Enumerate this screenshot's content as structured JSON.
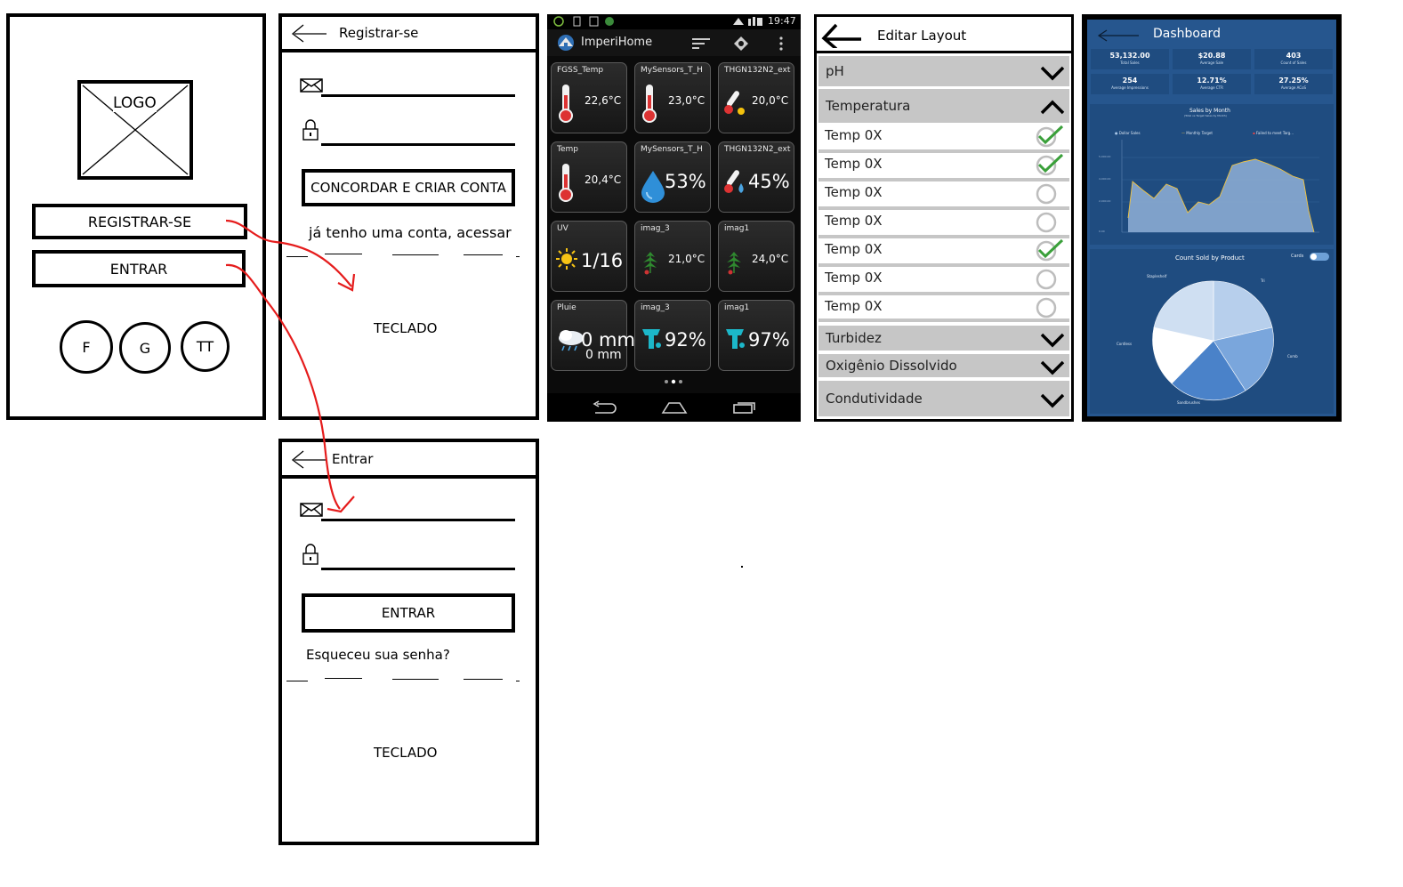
{
  "screen_home": {
    "logo_label": "LOGO",
    "register_button": "REGISTRAR-SE",
    "login_button": "ENTRAR",
    "social": [
      "F",
      "G",
      "TT"
    ]
  },
  "screen_register": {
    "title": "Registrar-se",
    "submit_button": "CONCORDAR E CRIAR CONTA",
    "have_account_text": "já tenho uma conta, acessar",
    "keyboard_label": "TECLADO"
  },
  "screen_login": {
    "title": "Entrar",
    "submit_button": "ENTRAR",
    "forgot_text": "Esqueceu sua senha?",
    "keyboard_label": "TECLADO"
  },
  "phone": {
    "status_time": "19:47",
    "app_title": "ImperiHome",
    "tiles": [
      {
        "label": "FGSS_Temp",
        "value": "22,6°C",
        "icon": "thermometer-icon"
      },
      {
        "label": "MySensors_T_H",
        "value": "23,0°C",
        "icon": "thermometer-icon"
      },
      {
        "label": "THGN132N2_ext",
        "value": "20,0°C",
        "icon": "thermometer-small-icon"
      },
      {
        "label": "Temp",
        "value": "20,4°C",
        "icon": "thermometer-icon"
      },
      {
        "label": "MySensors_T_H",
        "value": "53%",
        "icon": "water-drop-icon"
      },
      {
        "label": "THGN132N2_ext",
        "value": "45%",
        "icon": "thermometer-drop-icon"
      },
      {
        "label": "UV",
        "value": "1/16",
        "icon": "sun-icon"
      },
      {
        "label": "imag_3",
        "value": "21,0°C",
        "icon": "plant-icon"
      },
      {
        "label": "imag1",
        "value": "24,0°C",
        "icon": "plant-icon"
      },
      {
        "label": "Pluie",
        "value": "0 mm/h",
        "value2": "0 mm",
        "icon": "rain-cloud-icon"
      },
      {
        "label": "imag_3",
        "value": "92%",
        "icon": "humidity-icon"
      },
      {
        "label": "imag1",
        "value": "97%",
        "icon": "humidity-icon"
      }
    ]
  },
  "editor": {
    "title": "Editar Layout",
    "categories": [
      {
        "label": "pH"
      },
      {
        "label": "Temperatura"
      },
      {
        "label": "Turbidez"
      },
      {
        "label": "Oxigênio Dissolvido"
      },
      {
        "label": "Condutividade"
      }
    ],
    "items": [
      {
        "label": "Temp 0X",
        "checked": true
      },
      {
        "label": "Temp 0X",
        "checked": true
      },
      {
        "label": "Temp 0X",
        "checked": false
      },
      {
        "label": "Temp 0X",
        "checked": false
      },
      {
        "label": "Temp 0X",
        "checked": true
      },
      {
        "label": "Temp 0X",
        "checked": false
      },
      {
        "label": "Temp 0X",
        "checked": false
      }
    ]
  },
  "dashboard": {
    "title": "Dashboard",
    "kpis": [
      {
        "value": "53,132.00",
        "label": "Total Sales"
      },
      {
        "value": "$20.88",
        "label": "Average Sale"
      },
      {
        "value": "403",
        "label": "Count of Sales"
      },
      {
        "value": "254",
        "label": "Average Impressions"
      },
      {
        "value": "12.71%",
        "label": "Average CTR"
      },
      {
        "value": "27.25%",
        "label": "Average ACoS"
      }
    ],
    "line_chart_title": "Sales by Month",
    "line_chart_subtitle": "(Total vs Target Sales by Month)",
    "legend": [
      "Dollar Sales",
      "Monthly Target",
      "Failed to meet Targ..."
    ],
    "pie_chart_title": "Count Sold by Product",
    "toggle_label": "Cards",
    "pie_labels": [
      "Stapleshelf",
      "Tri",
      "Comb",
      "Sandbrushes",
      "Cordless"
    ]
  }
}
